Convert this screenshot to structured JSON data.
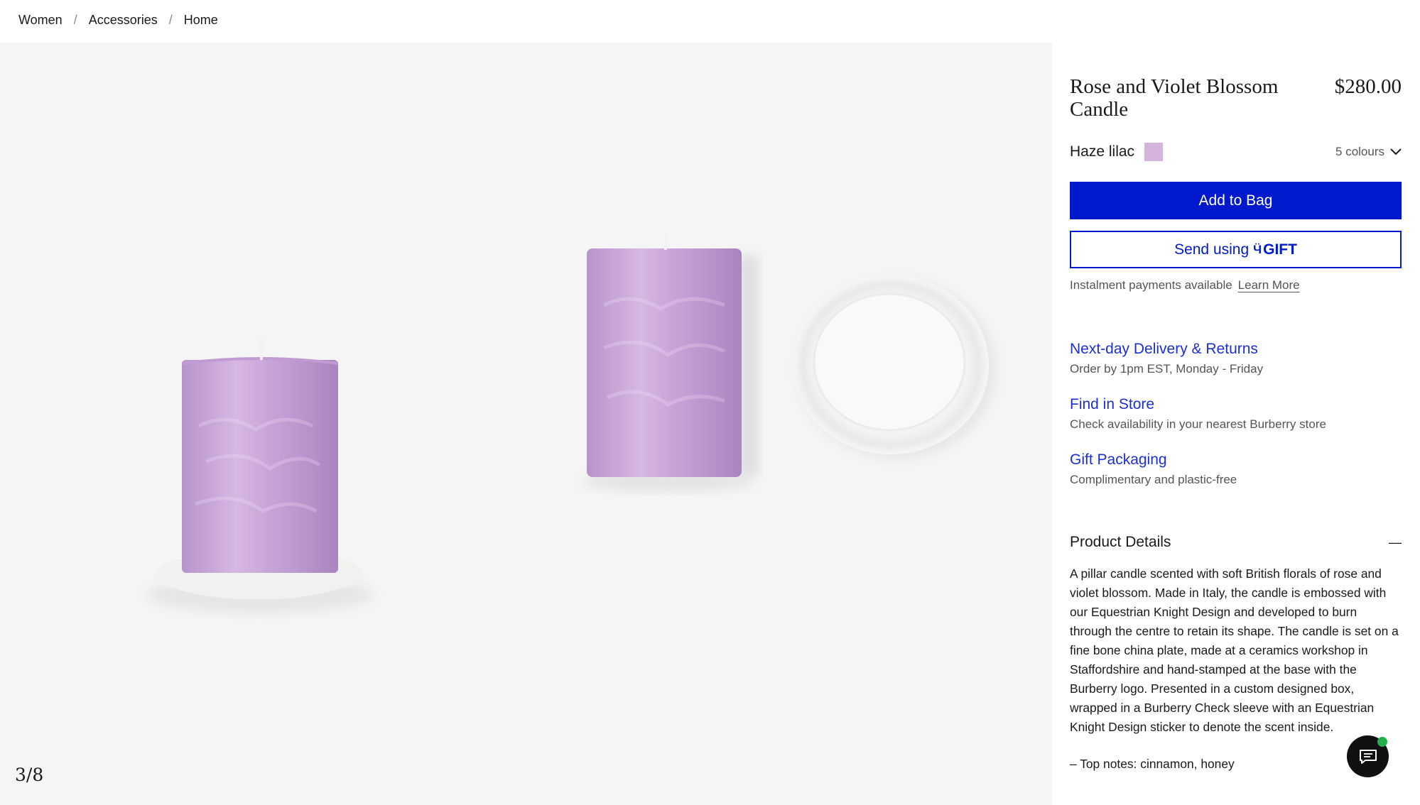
{
  "breadcrumb": {
    "items": [
      "Women",
      "Accessories",
      "Home"
    ],
    "separator": "/"
  },
  "gallery": {
    "counter": "3/8",
    "image_alt": "Rose and Violet Blossom Candle with bone china plate",
    "candle_color": "#c9a6db",
    "plate_color": "#f4f4f2"
  },
  "product": {
    "title": "Rose and Violet Blossom Candle",
    "price": "$280.00",
    "colour_name": "Haze lilac",
    "swatch_color": "#d4b3dc",
    "colours_label": "5 colours"
  },
  "actions": {
    "add_to_bag": "Add to Bag",
    "send_using": "Send using",
    "gift_brand": "GIFT",
    "gift_mark": "Ӵ",
    "primary_color": "#0019cc"
  },
  "instalment": {
    "text": "Instalment payments available",
    "link": "Learn More"
  },
  "services": [
    {
      "title": "Next-day Delivery & Returns",
      "desc": "Order by 1pm EST, Monday - Friday"
    },
    {
      "title": "Find in Store",
      "desc": "Check availability in your nearest Burberry store"
    },
    {
      "title": "Gift Packaging",
      "desc": "Complimentary and plastic-free"
    }
  ],
  "details": {
    "title": "Product Details",
    "toggle": "—",
    "body": "A pillar candle scented with soft British florals of rose and violet blossom. Made in Italy, the candle is embossed with our Equestrian Knight Design and developed to burn through the centre to retain its shape. The candle is set on a fine bone china plate, made at a ceramics workshop in Staffordshire and hand-stamped at the base with the Burberry logo. Presented in a custom designed box, wrapped in a Burberry Check sleeve with an Equestrian Knight Design sticker to denote the scent inside.",
    "notes": "– Top notes: cinnamon, honey"
  },
  "chat": {
    "icon": "chat-icon",
    "status_color": "#22b14c"
  },
  "colors": {
    "link_blue": "#1c2fd6",
    "muted_text": "#555555"
  }
}
